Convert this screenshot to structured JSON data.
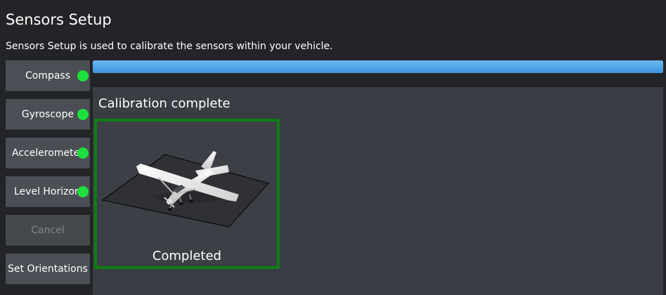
{
  "page": {
    "title": "Sensors Setup",
    "subtitle": "Sensors Setup is used to calibrate the sensors within your vehicle."
  },
  "sidebar": {
    "items": [
      {
        "label": "Compass",
        "status": "calibrated",
        "status_color": "#1ee03c"
      },
      {
        "label": "Gyroscope",
        "status": "calibrated",
        "status_color": "#1ee03c"
      },
      {
        "label": "Accelerometer",
        "status": "calibrated",
        "status_color": "#1ee03c"
      },
      {
        "label": "Level Horizon",
        "status": "calibrated",
        "status_color": "#1ee03c"
      }
    ],
    "cancel_label": "Cancel",
    "orientations_label": "Set Orientations"
  },
  "progress": {
    "value": 1.0,
    "color": "#4aa3e8"
  },
  "calibration": {
    "title": "Calibration complete",
    "status_text": "Completed",
    "border_color": "#0e7e14",
    "image_icon": "airplane-level-icon"
  }
}
